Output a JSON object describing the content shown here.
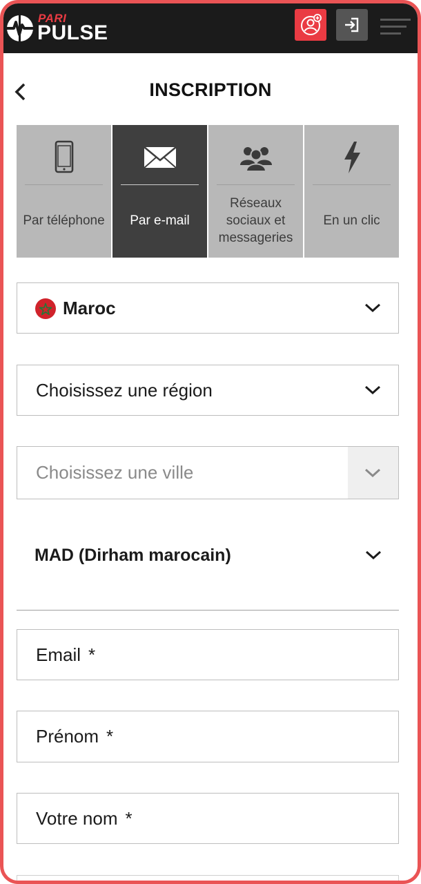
{
  "header": {
    "logo_top": "PARI",
    "logo_bottom": "PULSE",
    "brand_color": "#ea3b43",
    "icons": [
      "user-add-icon",
      "login-icon",
      "menu-icon"
    ]
  },
  "page": {
    "title": "INSCRIPTION"
  },
  "tabs": [
    {
      "label": "Par téléphone",
      "icon": "phone-icon",
      "active": false
    },
    {
      "label": "Par e-mail",
      "icon": "envelope-icon",
      "active": true
    },
    {
      "label": "Réseaux sociaux et messageries",
      "icon": "group-icon",
      "active": false
    },
    {
      "label": "En un clic",
      "icon": "lightning-icon",
      "active": false
    }
  ],
  "form": {
    "country": "Maroc",
    "region_placeholder": "Choisissez une région",
    "city_placeholder": "Choisissez une ville",
    "currency": "MAD (Dirham marocain)",
    "email_label": "Email",
    "firstname_label": "Prénom",
    "lastname_label": "Votre nom",
    "required_mark": "*"
  }
}
